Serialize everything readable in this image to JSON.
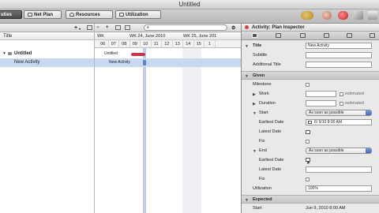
{
  "window": {
    "title": "Untitled"
  },
  "toolbar": {
    "segments": [
      {
        "label": "uties"
      },
      {
        "label": "Net Plan"
      },
      {
        "label": "Resources"
      },
      {
        "label": "Utilization"
      }
    ]
  },
  "outline": {
    "column_title": "Title",
    "groups": [
      {
        "label": "Untitled"
      }
    ],
    "activities": [
      {
        "label": "New Activity"
      }
    ]
  },
  "gantt": {
    "week_labels": [
      "WK",
      "WK 24, June 2010",
      "WK 25, June 201"
    ],
    "days": [
      "06",
      "07",
      "08",
      "09",
      "10",
      "11",
      "12",
      "13",
      "14",
      "15",
      "1"
    ],
    "bar_labels": {
      "group": "Untitled",
      "activity": "New Activity"
    }
  },
  "inspector": {
    "title": "Activity: Plan Inspector",
    "fields": {
      "title_label": "Title",
      "title_value": "New Activity",
      "subtitle_label": "Subtitle",
      "additional_title_label": "Additional Title"
    },
    "given": {
      "section": "Given",
      "milestone": "Milestone",
      "work": "Work",
      "duration": "Duration",
      "estimated": "estimated",
      "start": "Start",
      "start_mode": "As soon as possible",
      "earliest_date": "Earliest Date",
      "earliest_date_value": "6/ 9/10  8:00 AM",
      "latest_date": "Latest Date",
      "fix": "Fix",
      "end": "End",
      "end_mode": "As soon as possible",
      "utilization": "Utilization",
      "utilization_value": "100%"
    },
    "expected": {
      "section": "Expected",
      "start_label": "Start",
      "start_value": "Jun 9, 2010 8:00 AM"
    }
  },
  "colors": {
    "selection": "#c8d8ef",
    "today": "#bcd0ee",
    "bar_group": "#cc3344"
  }
}
